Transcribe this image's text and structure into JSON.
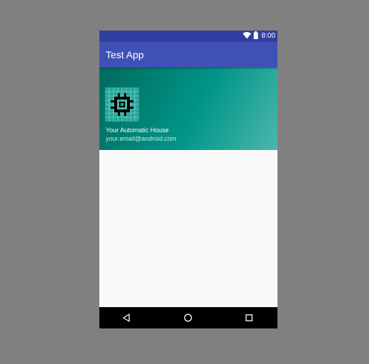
{
  "status_bar": {
    "time": "8:00",
    "icons": [
      "wifi-icon",
      "battery-icon"
    ]
  },
  "app_bar": {
    "title": "Test App"
  },
  "nav_header": {
    "logo_icon": "chip-icon",
    "name": "Your Automatic House",
    "email": "your.email@android.com"
  },
  "system_nav": {
    "buttons": [
      "back-icon",
      "home-icon",
      "recents-icon"
    ]
  },
  "colors": {
    "status_bar": "#303f9f",
    "app_bar": "#3f51b5",
    "header_gradient_start": "#00695c",
    "header_gradient_end": "#4db6ac",
    "background": "#fafafa",
    "nav_bar": "#000000"
  }
}
